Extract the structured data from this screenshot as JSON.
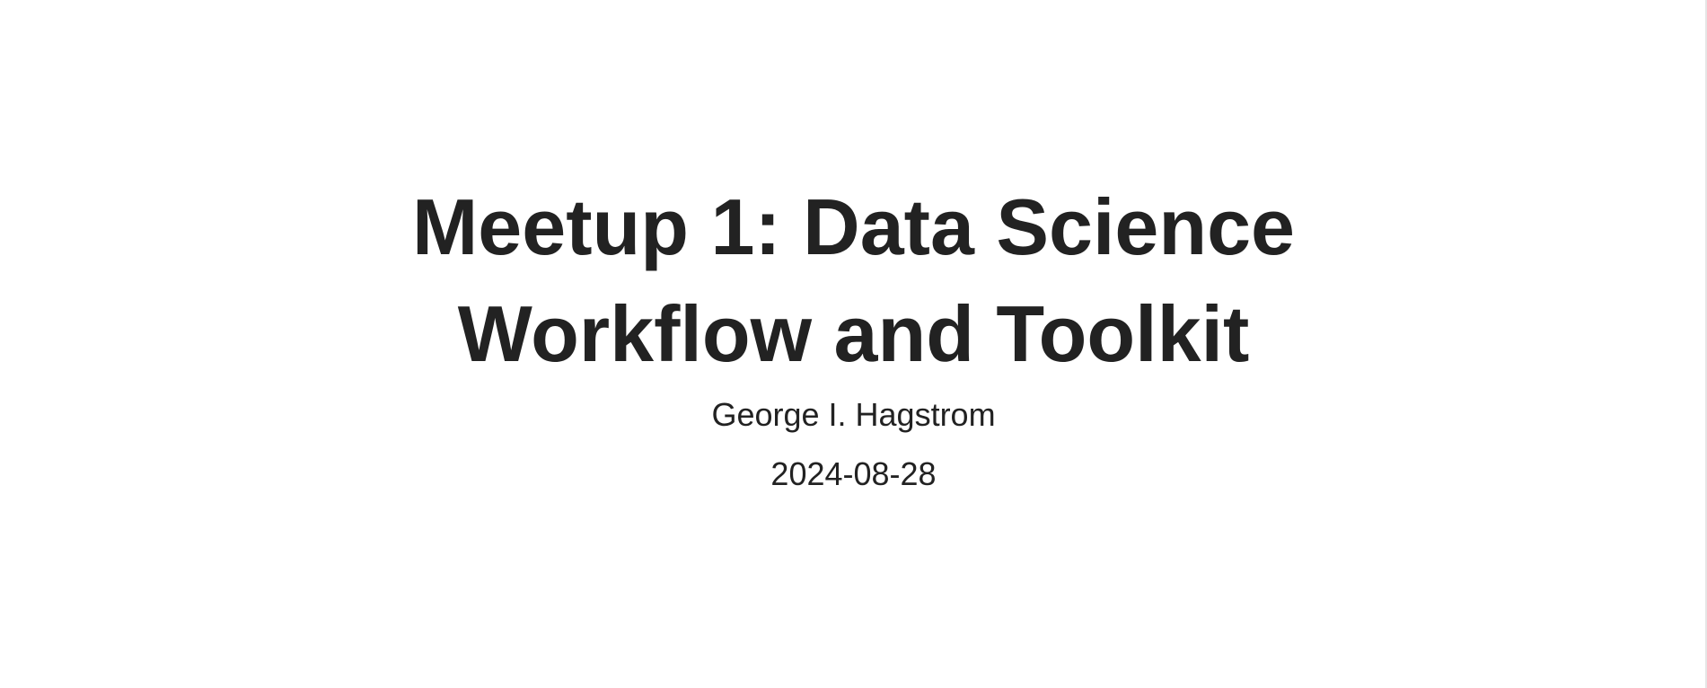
{
  "slide": {
    "title_line1": "Meetup 1: Data Science",
    "title_line2": "Workflow and Toolkit",
    "author": "George I. Hagstrom",
    "date": "2024-08-28"
  },
  "colors": {
    "background": "#ffffff",
    "text": "#222222",
    "edge": "#e6e6e6"
  }
}
